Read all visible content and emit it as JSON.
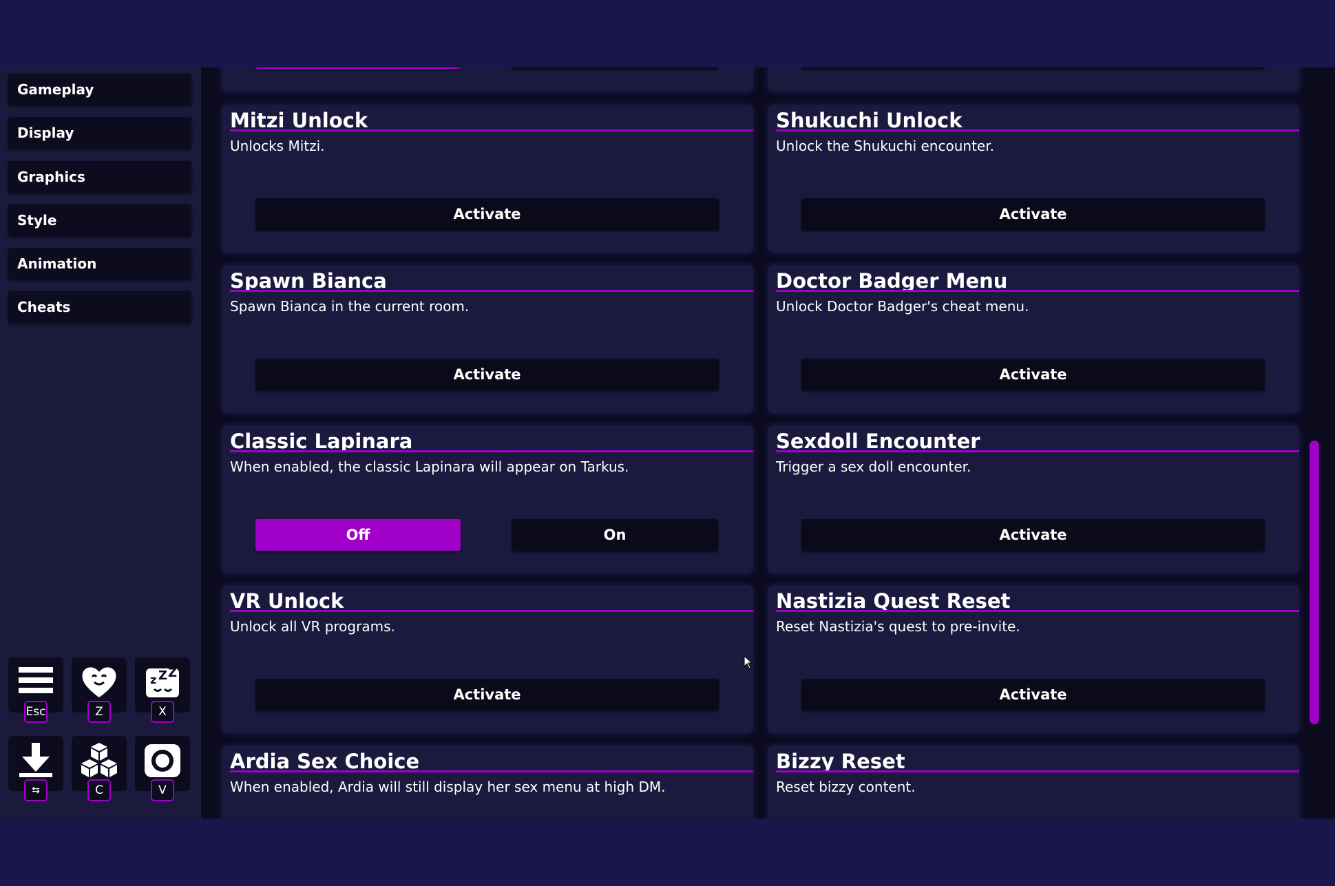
{
  "sidebar": {
    "items": [
      {
        "label": "Gameplay"
      },
      {
        "label": "Display"
      },
      {
        "label": "Graphics"
      },
      {
        "label": "Style"
      },
      {
        "label": "Animation"
      },
      {
        "label": "Cheats"
      }
    ]
  },
  "hotkeys": [
    {
      "icon": "menu-icon",
      "key": "Esc"
    },
    {
      "icon": "heart-icon",
      "key": "Z"
    },
    {
      "icon": "sleep-icon",
      "key": "X"
    },
    {
      "icon": "download-icon",
      "key": "⇆"
    },
    {
      "icon": "cubes-icon",
      "key": "C"
    },
    {
      "icon": "camera-icon",
      "key": "V"
    }
  ],
  "cheats": [
    {
      "title": "Mitzi Unlock",
      "desc": "Unlocks Mitzi.",
      "button": "Activate"
    },
    {
      "title": "Shukuchi Unlock",
      "desc": "Unlock the Shukuchi encounter.",
      "button": "Activate"
    },
    {
      "title": "Spawn Bianca",
      "desc": "Spawn Bianca in the current room.",
      "button": "Activate"
    },
    {
      "title": "Doctor Badger Menu",
      "desc": "Unlock Doctor Badger's cheat menu.",
      "button": "Activate"
    },
    {
      "title": "Classic Lapinara",
      "desc": "When enabled, the classic Lapinara will appear on Tarkus.",
      "off_label": "Off",
      "on_label": "On",
      "state": "Off"
    },
    {
      "title": "Sexdoll Encounter",
      "desc": "Trigger a sex doll encounter.",
      "button": "Activate"
    },
    {
      "title": "VR Unlock",
      "desc": "Unlock all VR programs.",
      "button": "Activate"
    },
    {
      "title": "Nastizia Quest Reset",
      "desc": "Reset Nastizia's quest to pre-invite.",
      "button": "Activate"
    },
    {
      "title": "Ardia Sex Choice",
      "desc": "When enabled, Ardia will still display her sex menu at high DM."
    },
    {
      "title": "Bizzy Reset",
      "desc": "Reset bizzy content."
    }
  ],
  "colors": {
    "accent": "#a000c8",
    "background": "#18164a",
    "card": "#1b1a3e",
    "button": "#0b0a1a"
  }
}
